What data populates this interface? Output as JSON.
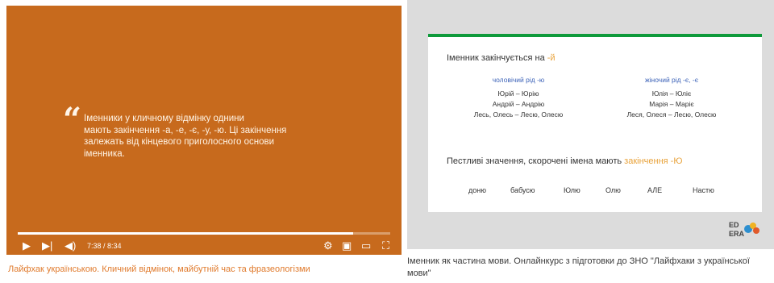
{
  "left_card": {
    "quote_mark": "“",
    "quote_lines": [
      "Іменники у кличному відмінку однини",
      "мають закінчення -а, -е, -є, -у, -ю. Ці закінчення",
      "залежать від кінцевого приголосного основи",
      "іменника."
    ],
    "time": "7:38 / 8:34",
    "progress": 0.9,
    "caption": "Лайфхак українською. Кличний відмінок, майбутній час та фразеологізми",
    "colors": {
      "player_bg": "#c76a1d",
      "caption": "#e07a2c"
    }
  },
  "right_card": {
    "slide": {
      "heading_prefix": "Іменник закінчується на ",
      "heading_accent": "-й",
      "left_col_head": "чоловічий рід -ю",
      "right_col_head": "жіночий рід -є, -є",
      "left_rows": [
        "Юрій – Юрію",
        "Андрій – Андрію",
        "Лесь, Олесь – Лесю, Олесю"
      ],
      "right_rows": [
        "Юлія – Юліє",
        "Марія – Маріє",
        "Леся, Олеся – Лесю, Олесю"
      ],
      "sub_prefix": "Пестливі значення, скорочені імена мають ",
      "sub_accent": "закінчення -Ю",
      "words": [
        "доню",
        "бабусю",
        "Юлю",
        "Олю",
        "АЛЕ",
        "Настю"
      ]
    },
    "logo": {
      "line1": "ED",
      "line2": "ERA"
    },
    "caption": "Іменник як частина мови. Онлайнкурс з підготовки до ЗНО \"Лайфхаки з української мови\"",
    "colors": {
      "thumb_bg": "#dcdcdc",
      "slide_top_bar": "#0e9a3b",
      "accent": "#e8a23a",
      "col_head": "#3d63b8"
    }
  }
}
